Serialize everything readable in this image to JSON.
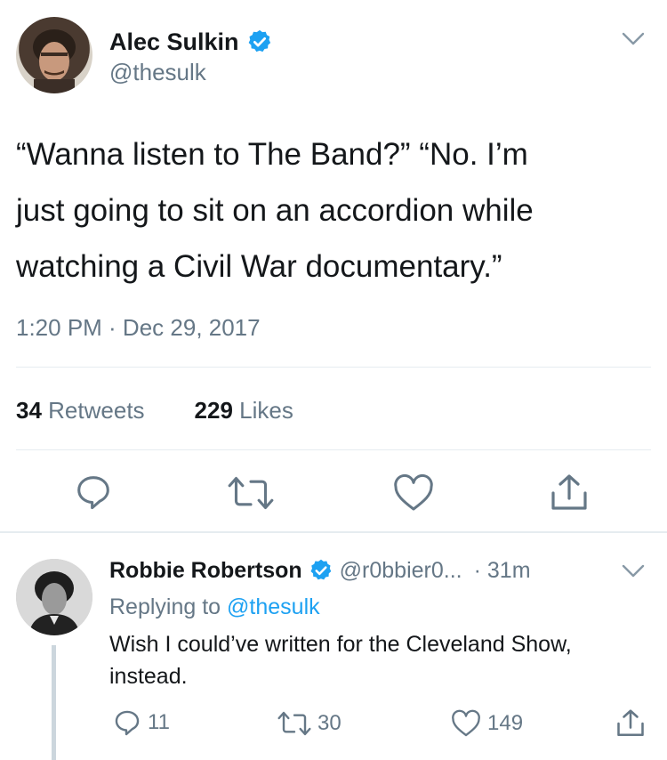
{
  "main_tweet": {
    "author_name": "Alec Sulkin",
    "handle": "@thesulk",
    "text_line1": "“Wanna listen to The Band?” “No. I’m",
    "text_line2": "just going to sit on an accordion while",
    "text_line3": "watching a Civil War documentary.”",
    "timestamp": "1:20 PM · Dec 29, 2017",
    "retweets_count": "34",
    "retweets_label": "Retweets",
    "likes_count": "229",
    "likes_label": "Likes"
  },
  "reply_tweet": {
    "author_name": "Robbie Robertson",
    "handle": "@r0bbier0...",
    "time": "· 31m",
    "replying_prefix": "Replying to",
    "replying_handle": "@thesulk",
    "text_line1": "Wish I could’ve written for the Cleveland Show,",
    "text_line2": "instead.",
    "reply_count": "11",
    "retweet_count": "30",
    "like_count": "149"
  },
  "colors": {
    "accent": "#1da1f2",
    "muted": "#657786",
    "divider": "#e6ecf0",
    "text": "#14171a"
  },
  "icons": [
    "chevron-down-icon",
    "verified-badge-icon",
    "reply-icon",
    "retweet-icon",
    "like-icon",
    "share-icon"
  ]
}
